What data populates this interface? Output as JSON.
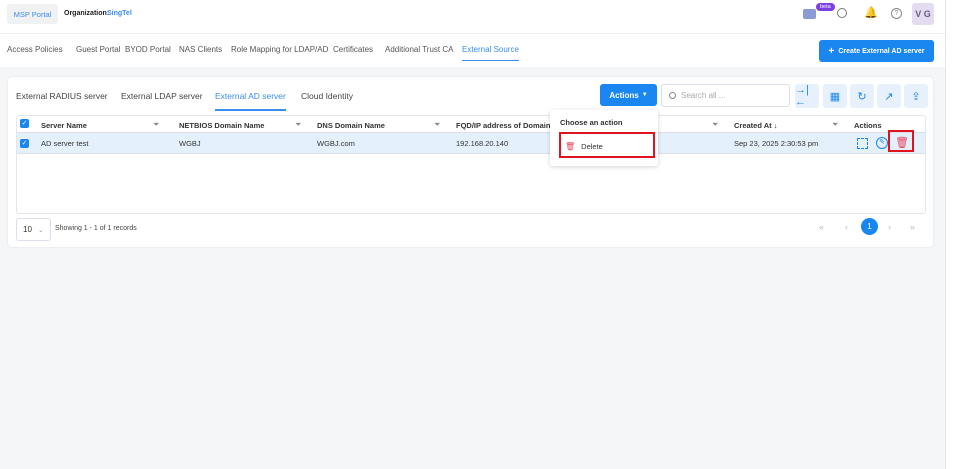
{
  "header": {
    "portal": "MSP Portal",
    "org_label": "Organization:",
    "org_value": "SingTel",
    "beta": "beta",
    "avatar": "V G"
  },
  "nav": {
    "items": [
      "Access Policies",
      "Guest Portal",
      "BYOD Portal",
      "NAS Clients",
      "Role Mapping for LDAP/AD",
      "Certificates",
      "Additional Trust CA",
      "External Source"
    ],
    "active": 7,
    "create_button": "Create External AD server"
  },
  "subtabs": {
    "items": [
      "External RADIUS server",
      "External LDAP server",
      "External AD server",
      "Cloud Identity"
    ],
    "active": 2
  },
  "toolbar": {
    "actions_label": "Actions",
    "search_placeholder": "Search all ..."
  },
  "menu": {
    "title": "Choose an action",
    "items": [
      "Delete"
    ]
  },
  "table": {
    "headers": [
      "Server Name",
      "NETBIOS Domain Name",
      "DNS Domain Name",
      "FQD/IP address of Domain c",
      "Created At",
      "Actions"
    ],
    "rows": [
      [
        "AD server test",
        "WGBJ",
        "WGBJ.com",
        "192.168.20.140",
        "Sep 23, 2025 2:30:53 pm"
      ]
    ]
  },
  "footer": {
    "page_size": "10",
    "showing": "Showing 1 - 1 of 1 records",
    "current_page": "1"
  },
  "colors": {
    "accent": "#1a86f0",
    "danger": "#e0141e",
    "beta": "#7b3fe4"
  }
}
